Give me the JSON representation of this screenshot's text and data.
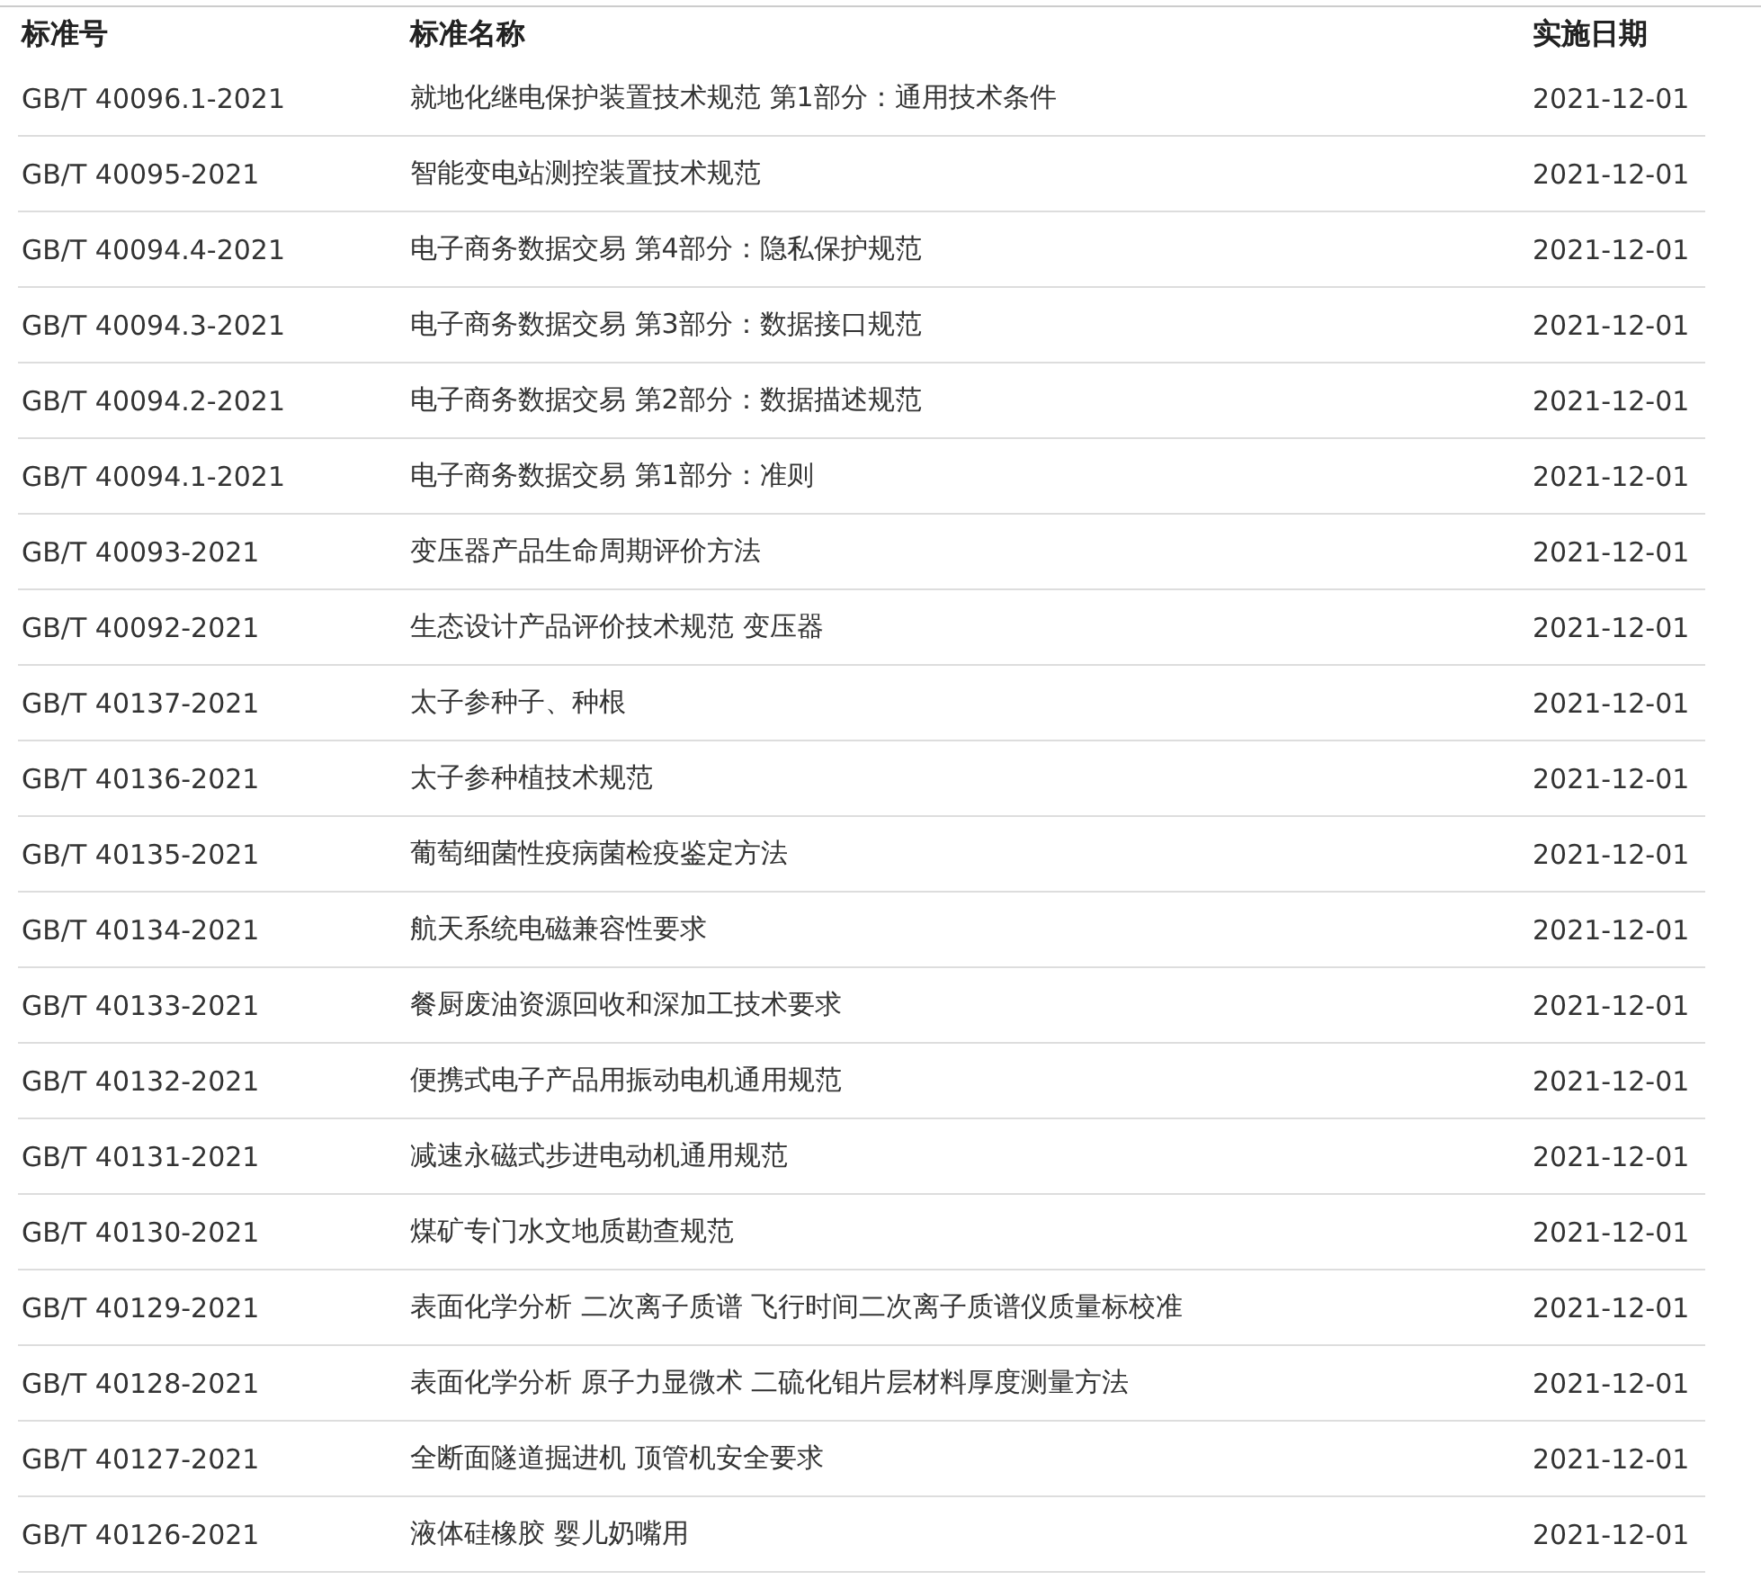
{
  "table": {
    "columns": [
      "标准号",
      "标准名称",
      "实施日期"
    ],
    "rows": [
      [
        "GB/T 40096.1-2021",
        "就地化继电保护装置技术规范 第1部分：通用技术条件",
        "2021-12-01"
      ],
      [
        "GB/T 40095-2021",
        "智能变电站测控装置技术规范",
        "2021-12-01"
      ],
      [
        "GB/T 40094.4-2021",
        "电子商务数据交易 第4部分：隐私保护规范",
        "2021-12-01"
      ],
      [
        "GB/T 40094.3-2021",
        "电子商务数据交易 第3部分：数据接口规范",
        "2021-12-01"
      ],
      [
        "GB/T 40094.2-2021",
        "电子商务数据交易 第2部分：数据描述规范",
        "2021-12-01"
      ],
      [
        "GB/T 40094.1-2021",
        "电子商务数据交易 第1部分：准则",
        "2021-12-01"
      ],
      [
        "GB/T 40093-2021",
        "变压器产品生命周期评价方法",
        "2021-12-01"
      ],
      [
        "GB/T 40092-2021",
        "生态设计产品评价技术规范 变压器",
        "2021-12-01"
      ],
      [
        "GB/T 40137-2021",
        "太子参种子、种根",
        "2021-12-01"
      ],
      [
        "GB/T 40136-2021",
        "太子参种植技术规范",
        "2021-12-01"
      ],
      [
        "GB/T 40135-2021",
        "葡萄细菌性疫病菌检疫鉴定方法",
        "2021-12-01"
      ],
      [
        "GB/T 40134-2021",
        "航天系统电磁兼容性要求",
        "2021-12-01"
      ],
      [
        "GB/T 40133-2021",
        "餐厨废油资源回收和深加工技术要求",
        "2021-12-01"
      ],
      [
        "GB/T 40132-2021",
        "便携式电子产品用振动电机通用规范",
        "2021-12-01"
      ],
      [
        "GB/T 40131-2021",
        "减速永磁式步进电动机通用规范",
        "2021-12-01"
      ],
      [
        "GB/T 40130-2021",
        "煤矿专门水文地质勘查规范",
        "2021-12-01"
      ],
      [
        "GB/T 40129-2021",
        "表面化学分析 二次离子质谱 飞行时间二次离子质谱仪质量标校准",
        "2021-12-01"
      ],
      [
        "GB/T 40128-2021",
        "表面化学分析 原子力显微术 二硫化钼片层材料厚度测量方法",
        "2021-12-01"
      ],
      [
        "GB/T 40127-2021",
        "全断面隧道掘进机 顶管机安全要求",
        "2021-12-01"
      ],
      [
        "GB/T 40126-2021",
        "液体硅橡胶 婴儿奶嘴用",
        "2021-12-01"
      ]
    ]
  }
}
